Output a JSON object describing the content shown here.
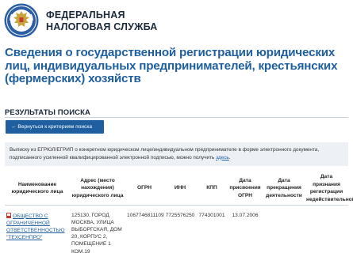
{
  "header": {
    "logo_line1": "ФЕДЕРАЛЬНАЯ",
    "logo_line2": "НАЛОГОВАЯ СЛУЖБА"
  },
  "page": {
    "title": "Сведения о государственной регистрации юридических лиц, индивидуальных предпринимателей, крестьянских (фермерских) хозяйств",
    "section_label": "РЕЗУЛЬТАТЫ ПОИСКА",
    "back_button": "← Вернуться к критериям поиска",
    "info_text": "Выписку из ЕГРЮЛ/ЕГРИП о конкретном юридическом лице/индивидуальном предпринимателе в форме электронного документа, подписанного усиленной квалифицированной электронной подписью, можно получить",
    "info_link": "здесь",
    "info_end": "."
  },
  "table": {
    "headers": {
      "name": "Наименование юридического лица",
      "address": "Адрес (место нахождения) юридического лица",
      "ogrn": "ОГРН",
      "inn": "ИНН",
      "kpp": "КПП",
      "reg_date": "Дата присвоения ОГРН",
      "end_date": "Дата прекращения деятельности",
      "invalid_date": "Дата признания регистрации недействительной"
    },
    "row": {
      "name": "ОБЩЕСТВО С ОГРАНИЧЕННОЙ ОТВЕТСТВЕННОСТЬЮ \"ТЕХСЕНПРО\"",
      "address": "125130, ГОРОД МОСКВА, УЛИЦА ВЫБОРГСКАЯ, ДОМ 20, КОРПУС 2, ПОМЕЩЕНИЕ 1 КОМ.19",
      "ogrn": "1067746811109",
      "inn": "7725576250",
      "kpp": "774301001",
      "reg_date": "13.07.2006",
      "end_date": "",
      "invalid_date": ""
    }
  },
  "colors": {
    "brand_blue": "#1f5fa0",
    "header_text": "#1b2a3a",
    "info_bg": "#edf1f5"
  },
  "icons": {
    "logo": "fns-eagle-emblem-icon",
    "row_doc": "pdf-document-icon"
  }
}
